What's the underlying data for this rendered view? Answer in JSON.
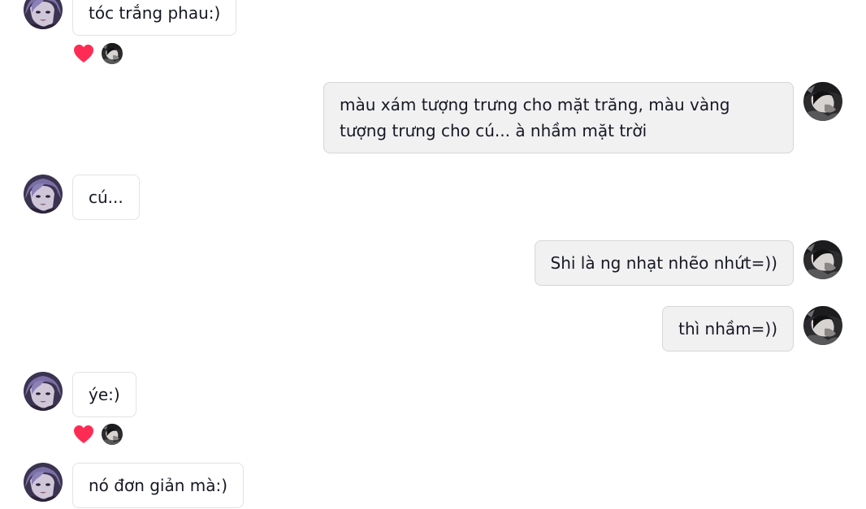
{
  "colors": {
    "incoming_bubble": "#ffffff",
    "outgoing_bubble": "#f1f1f2",
    "bubble_border": "#e3e3e4",
    "reaction_heart": "#fe2c55",
    "text": "#161823"
  },
  "messages": [
    {
      "sender": "other",
      "text": "tóc trắng phau:)",
      "reaction": "heart-icon"
    },
    {
      "sender": "me",
      "text": "màu xám tượng trưng cho mặt trăng, màu vàng tượng trưng cho cú... à nhầm mặt trời"
    },
    {
      "sender": "other",
      "text": "cú..."
    },
    {
      "sender": "me",
      "text": "Shi là ng nhạt nhẽo nhứt=))"
    },
    {
      "sender": "me",
      "text": "thì nhầm=))"
    },
    {
      "sender": "other",
      "text": "ýe:)",
      "reaction": "heart-icon"
    },
    {
      "sender": "other",
      "text": "nó đơn giản mà:)"
    }
  ]
}
